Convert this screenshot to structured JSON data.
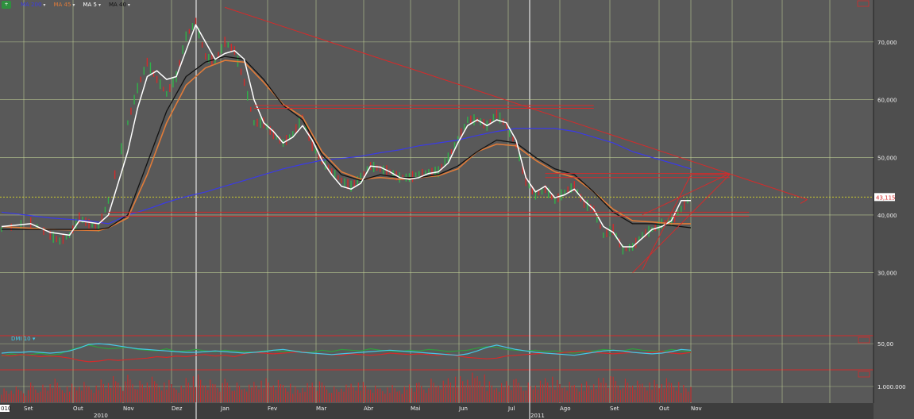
{
  "legend": {
    "symbol_badge": "+",
    "symbol_text": "",
    "items": [
      {
        "label": "MA 200",
        "color": "#3a3ae8"
      },
      {
        "label": "MA 45",
        "color": "#e07b39"
      },
      {
        "label": "MA 5",
        "color": "#ffffff"
      },
      {
        "label": "MA 40",
        "color": "#111111"
      }
    ]
  },
  "price_marker": "43,115",
  "indicator_label": "DMI 10",
  "volume_label": "",
  "chart_data": [
    {
      "type": "line",
      "name": "price",
      "x_ticks": [
        "Set",
        "Out",
        "Nov",
        "Dez",
        "Jan",
        "Fev",
        "Mar",
        "Abr",
        "Mai",
        "Jun",
        "Jul",
        "Ago",
        "Set",
        "Out",
        "Nov"
      ],
      "year_labels": [
        "2010",
        "2011"
      ],
      "left_edge_label": "010",
      "y_ticks": [
        "30,000",
        "40,000",
        "50,000",
        "60,000",
        "70,000"
      ],
      "ylim": [
        19500,
        77000
      ],
      "grid": true,
      "last_price": 43.115,
      "colors": {
        "price": "#2fb34a",
        "ma5": "#ffffff",
        "ma40": "#111111",
        "ma45": "#e07b39",
        "ma200": "#3a3ae8",
        "trend": "#d42b2b",
        "last_price_line": "#d9d92a"
      },
      "price_path": [
        [
          0,
          37.5
        ],
        [
          3,
          38.7
        ],
        [
          5,
          36.5
        ],
        [
          6,
          35.5
        ],
        [
          7,
          36.5
        ],
        [
          8,
          39.5
        ],
        [
          9,
          38.5
        ],
        [
          10,
          37.8
        ],
        [
          11,
          42.5
        ],
        [
          13,
          56
        ],
        [
          14,
          62
        ],
        [
          15,
          66.5
        ],
        [
          16,
          63.5
        ],
        [
          17,
          61
        ],
        [
          18,
          64
        ],
        [
          19,
          71
        ],
        [
          20,
          73.5
        ],
        [
          21,
          67.5
        ],
        [
          22,
          66.5
        ],
        [
          23,
          70
        ],
        [
          24,
          68.5
        ],
        [
          25,
          63
        ],
        [
          26,
          56
        ],
        [
          27,
          56
        ],
        [
          28,
          54
        ],
        [
          29,
          52.5
        ],
        [
          30,
          54
        ],
        [
          31,
          57
        ],
        [
          32,
          52
        ],
        [
          33,
          49.5
        ],
        [
          34,
          47.5
        ],
        [
          35,
          46
        ],
        [
          36,
          45
        ],
        [
          37,
          46.5
        ],
        [
          38,
          48.5
        ],
        [
          39,
          48
        ],
        [
          40,
          47.5
        ],
        [
          41,
          46.5
        ],
        [
          42,
          46.5
        ],
        [
          43,
          47
        ],
        [
          44,
          47.5
        ],
        [
          45,
          47.5
        ],
        [
          46,
          50
        ],
        [
          47,
          53
        ],
        [
          48,
          56.5
        ],
        [
          49,
          56.5
        ],
        [
          50,
          55.5
        ],
        [
          51,
          57.5
        ],
        [
          52,
          55.5
        ],
        [
          53,
          52
        ],
        [
          54,
          46
        ],
        [
          55,
          43.5
        ],
        [
          56,
          44.5
        ],
        [
          57,
          42.5
        ],
        [
          58,
          44
        ],
        [
          59,
          45
        ],
        [
          60,
          42
        ],
        [
          61,
          41
        ],
        [
          62,
          36.5
        ],
        [
          63,
          37.5
        ],
        [
          64,
          34
        ],
        [
          65,
          34.5
        ],
        [
          66,
          36.5
        ],
        [
          67,
          37.5
        ],
        [
          68,
          38.5
        ],
        [
          69,
          39
        ],
        [
          70,
          41
        ],
        [
          71,
          43.1
        ]
      ],
      "ma5_path": [
        [
          0,
          38
        ],
        [
          3,
          38.5
        ],
        [
          5,
          37
        ],
        [
          7,
          36.5
        ],
        [
          8,
          39
        ],
        [
          10,
          38.5
        ],
        [
          11,
          40
        ],
        [
          13,
          51
        ],
        [
          14,
          58.5
        ],
        [
          15,
          64
        ],
        [
          16,
          65
        ],
        [
          17,
          63.5
        ],
        [
          18,
          64
        ],
        [
          19,
          68.5
        ],
        [
          20,
          73
        ],
        [
          21,
          70
        ],
        [
          22,
          67
        ],
        [
          23,
          68
        ],
        [
          24,
          68.5
        ],
        [
          25,
          67
        ],
        [
          26,
          60
        ],
        [
          27,
          56
        ],
        [
          28,
          54.5
        ],
        [
          29,
          52.5
        ],
        [
          30,
          53.5
        ],
        [
          31,
          55.5
        ],
        [
          32,
          53
        ],
        [
          33,
          49.5
        ],
        [
          34,
          47
        ],
        [
          35,
          45
        ],
        [
          36,
          44.5
        ],
        [
          37,
          45.5
        ],
        [
          38,
          48.5
        ],
        [
          39,
          48.3
        ],
        [
          40,
          47.5
        ],
        [
          41,
          46.5
        ],
        [
          42,
          46.2
        ],
        [
          43,
          46.5
        ],
        [
          44,
          47.2
        ],
        [
          45,
          47.5
        ],
        [
          46,
          49
        ],
        [
          47,
          52.5
        ],
        [
          48,
          55.5
        ],
        [
          49,
          56.5
        ],
        [
          50,
          55.5
        ],
        [
          51,
          56.5
        ],
        [
          52,
          56
        ],
        [
          53,
          53
        ],
        [
          54,
          46.5
        ],
        [
          55,
          44
        ],
        [
          56,
          45
        ],
        [
          57,
          43
        ],
        [
          58,
          43.5
        ],
        [
          59,
          44.5
        ],
        [
          60,
          42.5
        ],
        [
          61,
          41
        ],
        [
          62,
          38
        ],
        [
          63,
          37
        ],
        [
          64,
          34.5
        ],
        [
          65,
          34.5
        ],
        [
          66,
          36
        ],
        [
          67,
          37.5
        ],
        [
          68,
          38
        ],
        [
          69,
          39
        ],
        [
          70,
          42.5
        ],
        [
          71,
          42.5
        ]
      ],
      "ma40_path": [
        [
          0,
          37.5
        ],
        [
          5,
          37.5
        ],
        [
          10,
          37.5
        ],
        [
          11,
          37.8
        ],
        [
          13,
          40
        ],
        [
          15,
          49
        ],
        [
          17,
          58
        ],
        [
          19,
          64
        ],
        [
          21,
          66.5
        ],
        [
          23,
          67.5
        ],
        [
          25,
          67
        ],
        [
          27,
          63.5
        ],
        [
          29,
          59
        ],
        [
          31,
          56.5
        ],
        [
          33,
          50.5
        ],
        [
          35,
          47
        ],
        [
          37,
          46
        ],
        [
          39,
          47
        ],
        [
          41,
          46.5
        ],
        [
          43,
          46.5
        ],
        [
          45,
          47
        ],
        [
          47,
          48.5
        ],
        [
          49,
          51
        ],
        [
          51,
          53
        ],
        [
          53,
          52.5
        ],
        [
          55,
          50
        ],
        [
          57,
          48
        ],
        [
          59,
          47
        ],
        [
          61,
          44
        ],
        [
          63,
          40.5
        ],
        [
          65,
          38.5
        ],
        [
          67,
          38.5
        ],
        [
          69,
          38.2
        ],
        [
          71,
          37.8
        ]
      ],
      "ma45_path": [
        [
          0,
          38
        ],
        [
          5,
          37.5
        ],
        [
          10,
          37.3
        ],
        [
          11,
          37.8
        ],
        [
          13,
          39.5
        ],
        [
          15,
          47
        ],
        [
          17,
          56
        ],
        [
          19,
          62.5
        ],
        [
          21,
          65.5
        ],
        [
          23,
          66.8
        ],
        [
          25,
          66.5
        ],
        [
          27,
          63
        ],
        [
          29,
          59.2
        ],
        [
          31,
          57
        ],
        [
          33,
          51
        ],
        [
          35,
          47.5
        ],
        [
          37,
          46.2
        ],
        [
          39,
          46.5
        ],
        [
          41,
          46.2
        ],
        [
          43,
          46.5
        ],
        [
          45,
          46.8
        ],
        [
          47,
          48
        ],
        [
          49,
          51
        ],
        [
          51,
          52.3
        ],
        [
          53,
          52
        ],
        [
          55,
          49.5
        ],
        [
          57,
          47.5
        ],
        [
          59,
          46.5
        ],
        [
          61,
          44
        ],
        [
          63,
          41
        ],
        [
          65,
          39
        ],
        [
          67,
          38.8
        ],
        [
          69,
          38.5
        ],
        [
          71,
          38.5
        ]
      ],
      "ma200_path": [
        [
          0,
          40.5
        ],
        [
          5,
          39.5
        ],
        [
          9,
          39
        ],
        [
          11,
          38.5
        ],
        [
          13,
          40
        ],
        [
          15,
          41
        ],
        [
          17,
          42.2
        ],
        [
          19,
          43.2
        ],
        [
          21,
          44
        ],
        [
          23,
          45
        ],
        [
          25,
          46
        ],
        [
          27,
          47
        ],
        [
          29,
          48
        ],
        [
          31,
          48.8
        ],
        [
          33,
          49.5
        ],
        [
          35,
          49.8
        ],
        [
          37,
          50.2
        ],
        [
          39,
          50.8
        ],
        [
          41,
          51.3
        ],
        [
          43,
          52
        ],
        [
          45,
          52.5
        ],
        [
          47,
          53
        ],
        [
          49,
          53.8
        ],
        [
          51,
          54.5
        ],
        [
          53,
          55
        ],
        [
          55,
          55
        ],
        [
          57,
          55
        ],
        [
          59,
          54.5
        ],
        [
          61,
          53.5
        ],
        [
          63,
          52.5
        ],
        [
          65,
          51
        ],
        [
          67,
          50
        ],
        [
          69,
          49
        ],
        [
          71,
          48
        ]
      ],
      "trendlines": [
        [
          [
            23,
            76
          ],
          [
            83,
            42.7
          ]
        ],
        [
          [
            26,
            58.5
          ],
          [
            61,
            58.5
          ]
        ],
        [
          [
            26,
            59
          ],
          [
            61,
            59
          ]
        ],
        [
          [
            11,
            40.5
          ],
          [
            77,
            40.5
          ]
        ],
        [
          [
            11,
            39.8
          ],
          [
            77,
            39.8
          ]
        ],
        [
          [
            56,
            47.2
          ],
          [
            75,
            47.2
          ]
        ],
        [
          [
            56,
            46.5
          ],
          [
            75,
            46.5
          ]
        ],
        [
          [
            65,
            30
          ],
          [
            75,
            47
          ]
        ],
        [
          [
            66,
            30.5
          ],
          [
            71,
            47
          ]
        ],
        [
          [
            75,
            47
          ],
          [
            71,
            47
          ]
        ],
        [
          [
            66,
            40
          ],
          [
            75,
            47.2
          ]
        ]
      ]
    },
    {
      "type": "line",
      "name": "DMI 10",
      "y_ticks": [
        "50,00"
      ],
      "markers": [
        "",
        ""
      ],
      "series": [
        {
          "name": "di_plus",
          "color": "#2e9e3e",
          "values": [
            33,
            36,
            34,
            35,
            37,
            34,
            36,
            41,
            45,
            48,
            45,
            43,
            44,
            45,
            42,
            41,
            40,
            43,
            39,
            40,
            42,
            40,
            39,
            41,
            40,
            39,
            38,
            40,
            41,
            39,
            40,
            39,
            38,
            41,
            39,
            42,
            41,
            40,
            43,
            41,
            40,
            39,
            41,
            40,
            42,
            41,
            39,
            40,
            41,
            44,
            46,
            45,
            42,
            41,
            40,
            41,
            39,
            40,
            38,
            37,
            39,
            40,
            42,
            41,
            40,
            43,
            41,
            40,
            39,
            42,
            40,
            39
          ]
        },
        {
          "name": "di_minus",
          "color": "#d42b2b",
          "values": [
            34,
            33,
            35,
            34,
            32,
            33,
            32,
            30,
            27,
            25,
            26,
            28,
            27,
            28,
            29,
            30,
            32,
            31,
            33,
            32,
            34,
            35,
            33,
            34,
            32,
            36,
            38,
            37,
            36,
            37,
            38,
            39,
            37,
            36,
            35,
            34,
            36,
            35,
            34,
            35,
            37,
            36,
            35,
            36,
            35,
            34,
            36,
            33,
            31,
            30,
            29,
            30,
            33,
            34,
            35,
            36,
            37,
            36,
            38,
            39,
            40,
            38,
            37,
            36,
            37,
            38,
            37,
            38,
            39,
            37,
            36,
            38
          ]
        },
        {
          "name": "adx",
          "color": "#44c8e8",
          "values": [
            37,
            38,
            38,
            39,
            38,
            37,
            38,
            40,
            44,
            49,
            50,
            49,
            47,
            45,
            43,
            42,
            41,
            40,
            39,
            38,
            38,
            39,
            40,
            39,
            38,
            37,
            38,
            39,
            41,
            42,
            40,
            38,
            37,
            36,
            35,
            36,
            37,
            38,
            39,
            40,
            41,
            40,
            39,
            38,
            37,
            36,
            35,
            34,
            36,
            40,
            45,
            48,
            45,
            42,
            40,
            38,
            37,
            36,
            35,
            34,
            36,
            38,
            40,
            41,
            40,
            38,
            37,
            36,
            37,
            39,
            42,
            41
          ]
        }
      ]
    },
    {
      "type": "bar",
      "name": "volume",
      "y_ticks": [
        "1.000.000"
      ],
      "markers": [
        ""
      ],
      "color": "#c03030",
      "values": [
        0.8,
        0.9,
        0.7,
        1.0,
        0.9,
        1.2,
        0.8,
        1.0,
        1.1,
        0.9,
        1.3,
        1.5,
        1.2,
        1.4,
        1.1,
        1.3,
        1.0,
        1.2,
        0.9,
        1.4,
        1.6,
        1.3,
        1.1,
        1.2,
        1.0,
        0.9,
        1.1,
        1.3,
        1.2,
        1.0,
        0.9,
        1.1,
        1.2,
        1.0,
        0.8,
        0.9,
        1.0,
        1.1,
        0.9,
        0.8,
        1.0,
        0.9,
        1.1,
        1.0,
        1.2,
        1.1,
        1.3,
        1.4,
        1.6,
        1.5,
        1.2,
        1.1,
        1.3,
        1.2,
        1.0,
        1.1,
        1.3,
        1.2,
        1.1,
        1.0,
        1.2,
        1.4,
        1.5,
        1.3,
        1.2,
        1.1,
        1.0,
        1.2,
        1.3,
        1.1,
        1.0,
        1.2
      ]
    }
  ]
}
